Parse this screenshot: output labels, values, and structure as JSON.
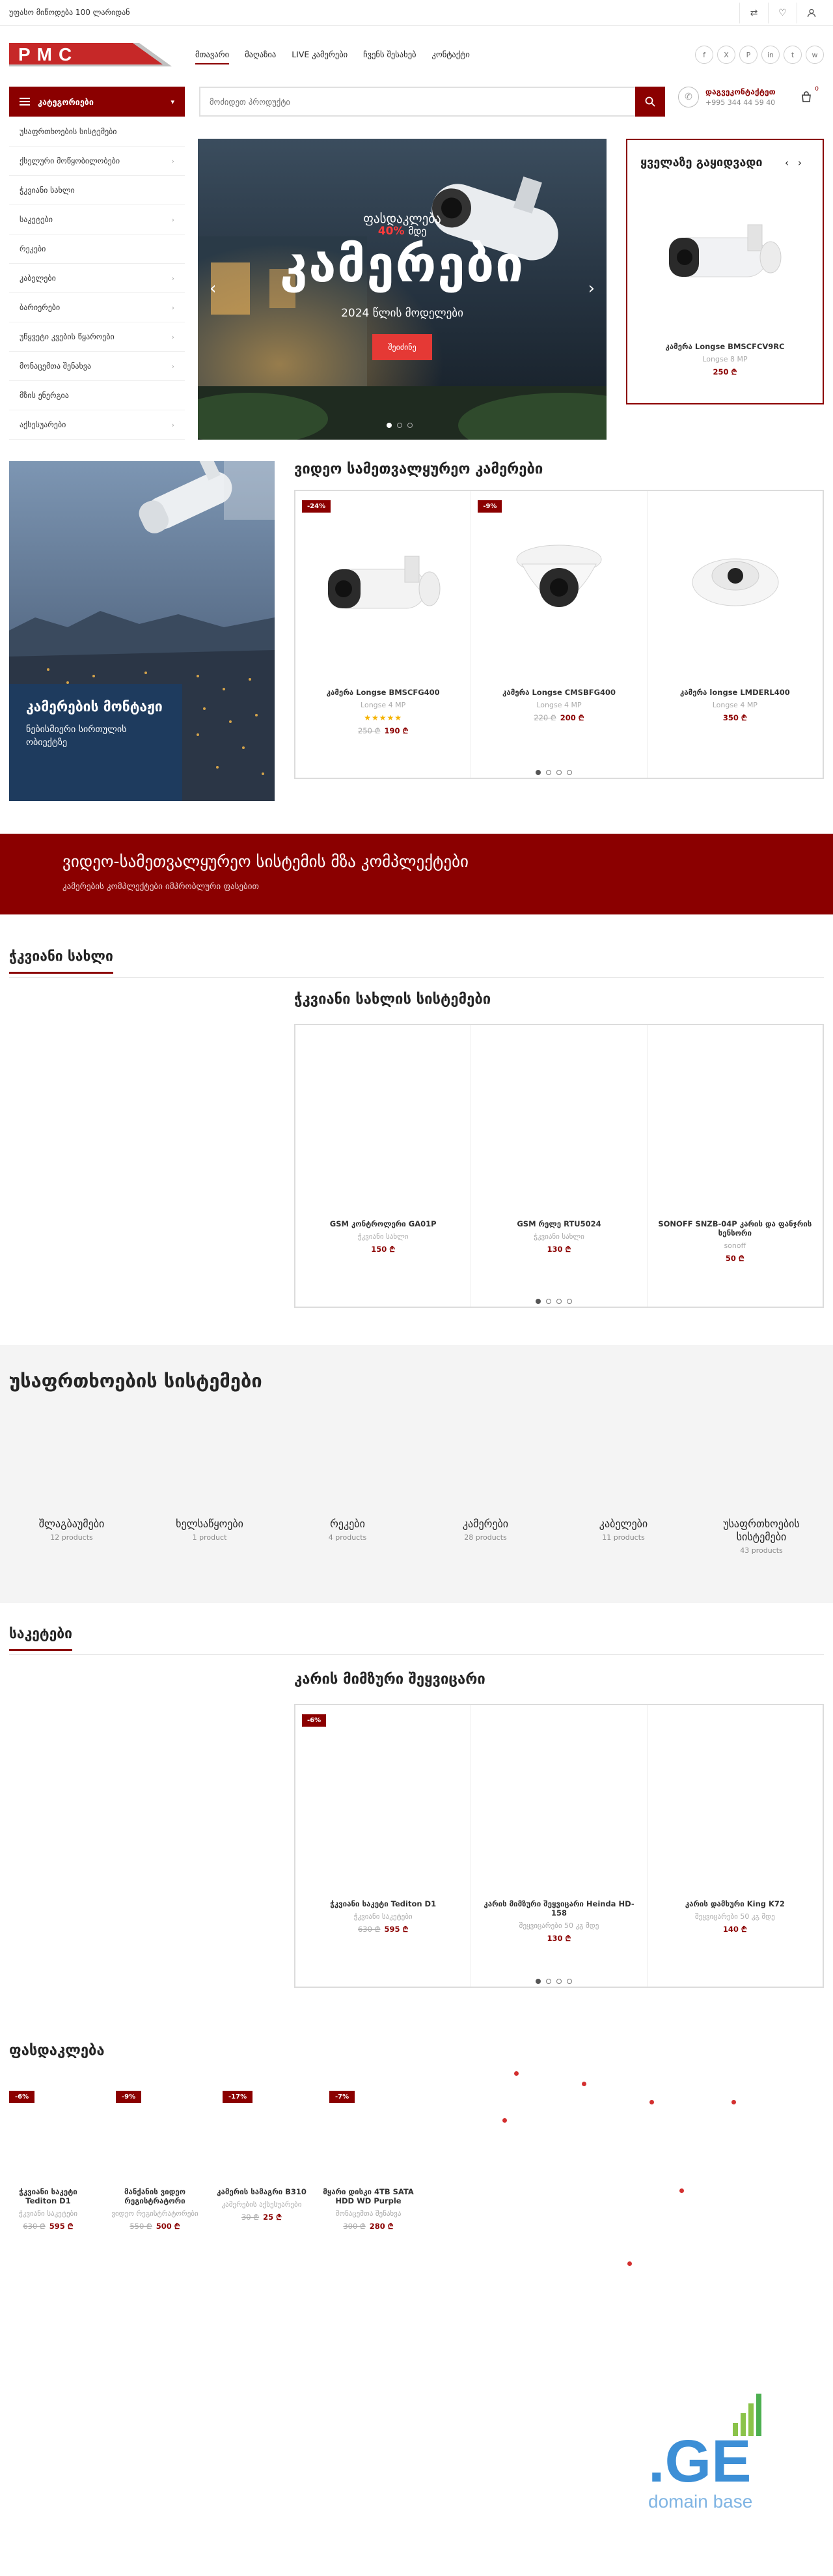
{
  "topbar": {
    "promo": "უფასო მიწოდება 100 ლარიდან"
  },
  "header": {
    "logo_text": "PMC",
    "nav": [
      "მთავარი",
      "მაღაზია",
      "LIVE კამერები",
      "ჩვენს შესახებ",
      "კონტაქტი"
    ],
    "socials": [
      "f",
      "X",
      "P",
      "in",
      "t",
      "w"
    ]
  },
  "catbar": {
    "label": "კატეგორიები",
    "search_placeholder": "მოძიდეთ პროდუქტი",
    "phone_title": "დაგვეკონტაქტეთ",
    "phone_number": "+995 344 44 59 40",
    "cart_count": "0"
  },
  "sidebar": [
    {
      "label": "უსაფრთხოების სისტემები",
      "has_sub": false
    },
    {
      "label": "ქსელური მოწყობილობები",
      "has_sub": true
    },
    {
      "label": "ჭკვიანი სახლი",
      "has_sub": false
    },
    {
      "label": "საკეტები",
      "has_sub": true
    },
    {
      "label": "რეკები",
      "has_sub": false
    },
    {
      "label": "კაბელები",
      "has_sub": true
    },
    {
      "label": "ბარიერები",
      "has_sub": true
    },
    {
      "label": "უწყვეტი კვების წყაროები",
      "has_sub": true
    },
    {
      "label": "მონაცემთა შენახვა",
      "has_sub": true
    },
    {
      "label": "მზის ენერგია",
      "has_sub": false
    },
    {
      "label": "აქსესუარები",
      "has_sub": true
    }
  ],
  "hero": {
    "sale": "ფასდაკლება",
    "percent": "40%",
    "percent_suffix": "მდე",
    "title": "კამერები",
    "subtitle": "2024 წლის მოდელები",
    "cta": "შეიძინე"
  },
  "bestseller": {
    "title": "ყველაზე გაყიდვადი",
    "name": "კამერა Longse BMSCFCV9RC",
    "brand": "Longse 8 MP",
    "price": "250 ₾"
  },
  "banner_left": {
    "title": "კამერების მონტაჟი",
    "subtitle": "ნებისმიერი სირთულის ობიექტზე"
  },
  "video_section": {
    "title": "ვიდეო სამეთვალყურეო კამერები",
    "products": [
      {
        "discount": "-24%",
        "name": "კამერა Longse BMSCFG400",
        "brand": "Longse 4 MP",
        "old_price": "250 ₾",
        "price": "190 ₾",
        "stars": "★★★★★"
      },
      {
        "discount": "-9%",
        "name": "კამერა Longse CMSBFG400",
        "brand": "Longse 4 MP",
        "old_price": "220 ₾",
        "price": "200 ₾",
        "stars": ""
      },
      {
        "discount": "",
        "name": "კამერა longse LMDERL400",
        "brand": "Longse 4 MP",
        "old_price": "",
        "price": "350 ₾",
        "stars": ""
      }
    ]
  },
  "band": {
    "title": "ვიდეო-სამეთვალყურეო სისტემის მზა კომპლექტები",
    "subtitle": "კამერების კომპლექტები იმპრობლური ფასებით"
  },
  "smart_home": {
    "header": "ჭკვიანი სახლი",
    "title": "ჭკვიანი სახლის სისტემები",
    "products": [
      {
        "discount": "",
        "name": "GSM კონტროლერი GA01P",
        "brand": "ჭკვიანი სახლი",
        "old_price": "",
        "price": "150 ₾"
      },
      {
        "discount": "",
        "name": "GSM რელე RTU5024",
        "brand": "ჭკვიანი სახლი",
        "old_price": "",
        "price": "130 ₾"
      },
      {
        "discount": "",
        "name": "SONOFF SNZB-04P კარის და ფანჯრის სენსორი",
        "brand": "sonoff",
        "old_price": "",
        "price": "50 ₾"
      }
    ]
  },
  "security": {
    "title": "უსაფრთხოების სისტემები",
    "categories": [
      {
        "name": "შლაგბაუმები",
        "count": "12 products"
      },
      {
        "name": "ხელსაწყოები",
        "count": "1 product"
      },
      {
        "name": "რეკები",
        "count": "4 products"
      },
      {
        "name": "კამერები",
        "count": "28 products"
      },
      {
        "name": "კაბელები",
        "count": "11 products"
      },
      {
        "name": "უსაფრთხოების სისტემები",
        "count": "43 products"
      }
    ]
  },
  "locks": {
    "header": "საკეტები",
    "title": "კარის მიმზური შეყვიცარი",
    "products": [
      {
        "discount": "-6%",
        "name": "ჭკვიანი საკეტი Tediton D1",
        "brand": "ჭკვიანი საკეტები",
        "old_price": "630 ₾",
        "price": "595 ₾"
      },
      {
        "discount": "",
        "name": "კარის მიმზური შეყვიცარი Heinda HD-158",
        "brand": "შეყვიცარები 50 კგ მდე",
        "old_price": "",
        "price": "130 ₾"
      },
      {
        "discount": "",
        "name": "კარის დამხური King K72",
        "brand": "შეყვიცარები 50 კგ მდე",
        "old_price": "",
        "price": "140 ₾"
      }
    ]
  },
  "sale": {
    "header": "ფასდაკლება",
    "items": [
      {
        "discount": "-6%",
        "name": "ჭკვიანი საკეტი Tediton D1",
        "brand": "ჭკვიანი საკეტები",
        "old_price": "630 ₾",
        "price": "595 ₾"
      },
      {
        "discount": "-9%",
        "name": "მანქანის ვიდეო რეგისტრატორი",
        "brand": "ვიდეო რეგისტრატორები",
        "old_price": "550 ₾",
        "price": "500 ₾"
      },
      {
        "discount": "-17%",
        "name": "კამერის სამაგრი B310",
        "brand": "კამერების აქსესუარები",
        "old_price": "30 ₾",
        "price": "25 ₾"
      },
      {
        "discount": "-7%",
        "name": "მყარი დისკი 4TB SATA HDD WD Purple",
        "brand": "მონაცემთა შენახვა",
        "old_price": "300 ₾",
        "price": "280 ₾"
      }
    ]
  },
  "domain_logo": {
    "mark": ".GE",
    "caption": "domain base"
  },
  "colors": {
    "brand": "#8b0000",
    "accent": "#e53935",
    "star": "#f5b301"
  }
}
